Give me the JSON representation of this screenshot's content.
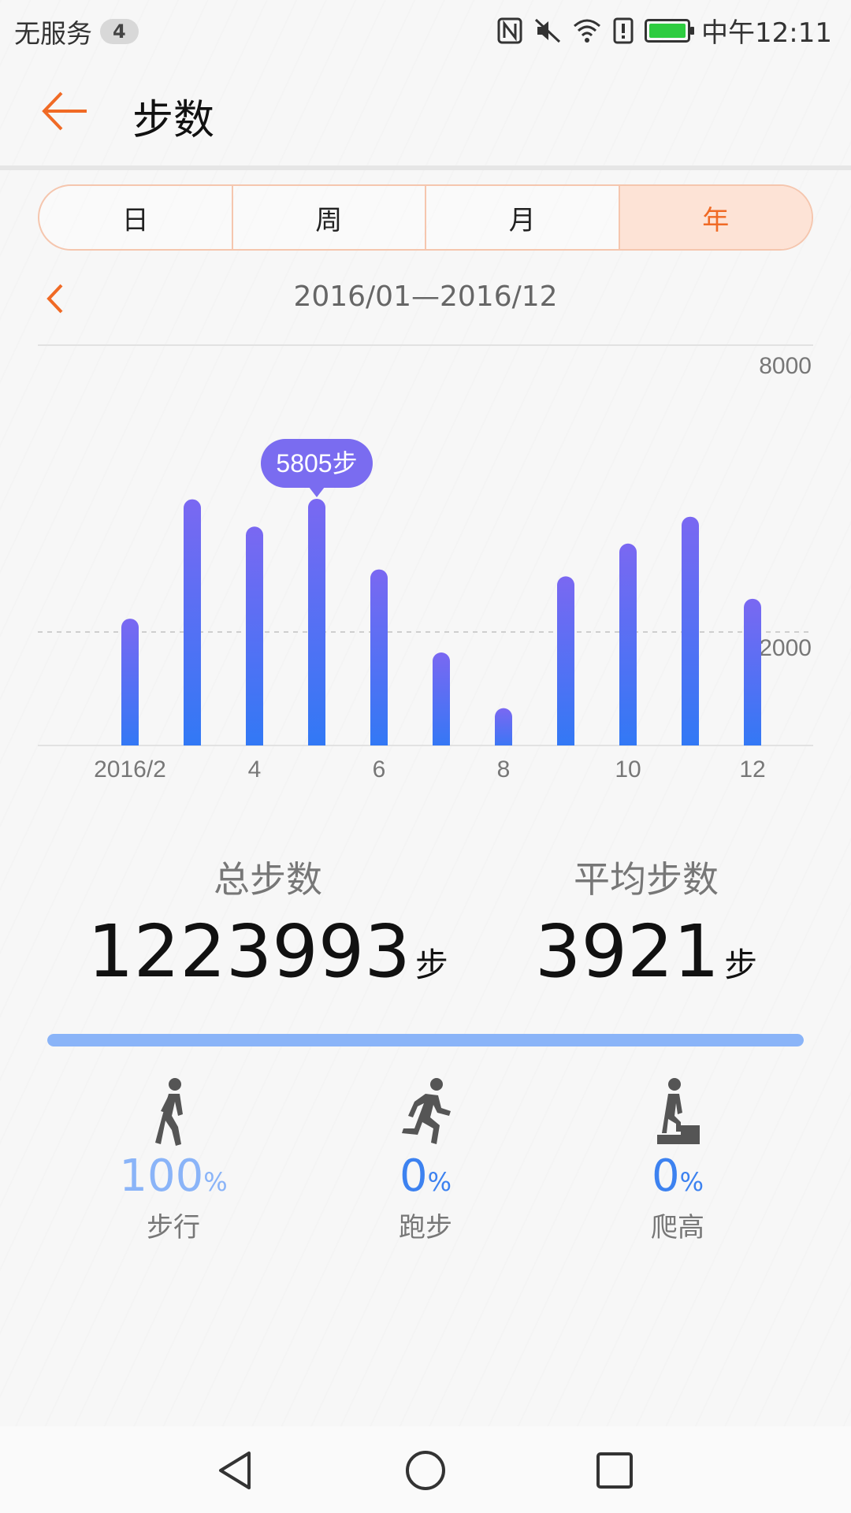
{
  "status_bar": {
    "carrier": "无服务",
    "badge": "4",
    "time": "中午12:11",
    "icons": [
      "nfc-icon",
      "mute-icon",
      "wifi-icon",
      "alert-icon",
      "battery-icon"
    ]
  },
  "header": {
    "title": "步数",
    "back_icon": "arrow-left-icon"
  },
  "tabs": [
    {
      "label": "日",
      "active": false
    },
    {
      "label": "周",
      "active": false
    },
    {
      "label": "月",
      "active": false
    },
    {
      "label": "年",
      "active": true
    }
  ],
  "period": {
    "label": "2016/01—2016/12",
    "prev_icon": "chevron-left-icon"
  },
  "chart_data": {
    "type": "bar",
    "categories": [
      "2016/2",
      "",
      "4",
      "",
      "6",
      "",
      "8",
      "",
      "10",
      "",
      "12"
    ],
    "values": [
      2550,
      4950,
      4400,
      4960,
      3540,
      1870,
      750,
      3400,
      4060,
      4600,
      2950
    ],
    "y_gridlines": [
      8000,
      2000
    ],
    "ylim": [
      0,
      6750
    ],
    "highlight_index": 3,
    "tooltip": "5805步",
    "bar_color_top": "#7a68f2",
    "bar_color_bottom": "#2f79f5"
  },
  "summary": {
    "total": {
      "label": "总步数",
      "value": "1223993",
      "unit": "步"
    },
    "average": {
      "label": "平均步数",
      "value": "3921",
      "unit": "步"
    }
  },
  "progress": {
    "walk_fraction": 1.0,
    "color": "#8ab4f8"
  },
  "activities": [
    {
      "icon": "walking-icon",
      "value": "100",
      "unit": "%",
      "label": "步行",
      "color": "#8ab4f8"
    },
    {
      "icon": "running-icon",
      "value": "0",
      "unit": "%",
      "label": "跑步",
      "color": "#3d82f0"
    },
    {
      "icon": "climbing-icon",
      "value": "0",
      "unit": "%",
      "label": "爬高",
      "color": "#3d82f0"
    }
  ],
  "nav": {
    "icons": [
      "back-triangle-icon",
      "home-circle-icon",
      "recents-square-icon"
    ]
  }
}
